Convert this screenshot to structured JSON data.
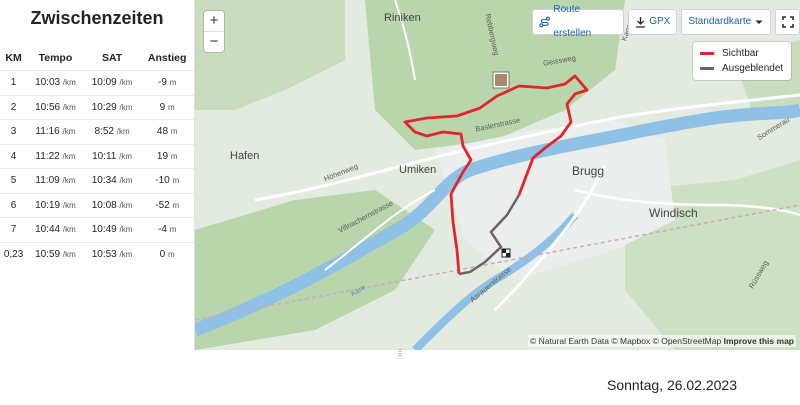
{
  "splits": {
    "title": "Zwischenzeiten",
    "headers": {
      "km": "KM",
      "tempo": "Tempo",
      "sat": "SAT",
      "anstieg": "Anstieg"
    },
    "rows": [
      {
        "km": "1",
        "tempo": "10:03",
        "sat": "10:09",
        "anstieg": "-9",
        "unit_pace": "/km",
        "unit_elev": "m"
      },
      {
        "km": "2",
        "tempo": "10:56",
        "sat": "10:29",
        "anstieg": "9",
        "unit_pace": "/km",
        "unit_elev": "m"
      },
      {
        "km": "3",
        "tempo": "11:16",
        "sat": "8:52",
        "anstieg": "48",
        "unit_pace": "/km",
        "unit_elev": "m"
      },
      {
        "km": "4",
        "tempo": "11:22",
        "sat": "10:11",
        "anstieg": "19",
        "unit_pace": "/km",
        "unit_elev": "m"
      },
      {
        "km": "5",
        "tempo": "11:09",
        "sat": "10:34",
        "anstieg": "-10",
        "unit_pace": "/km",
        "unit_elev": "m"
      },
      {
        "km": "6",
        "tempo": "10:19",
        "sat": "10:08",
        "anstieg": "-52",
        "unit_pace": "/km",
        "unit_elev": "m"
      },
      {
        "km": "7",
        "tempo": "10:44",
        "sat": "10:49",
        "anstieg": "-4",
        "unit_pace": "/km",
        "unit_elev": "m"
      },
      {
        "km": "0,23",
        "tempo": "10:59",
        "sat": "10:53",
        "anstieg": "0",
        "unit_pace": "/km",
        "unit_elev": "m"
      }
    ]
  },
  "map": {
    "zoom_in": "+",
    "zoom_out": "−",
    "toolbar": {
      "route": "Route erstellen",
      "gpx": "GPX",
      "map_type": "Standardkarte"
    },
    "legend": [
      {
        "label": "Sichtbar",
        "color": "#e3242b"
      },
      {
        "label": "Ausgeblendet",
        "color": "#6e6266"
      }
    ],
    "places": {
      "riniken": "Riniken",
      "hafen": "Hafen",
      "umiken": "Umiken",
      "brugg": "Brugg",
      "windisch": "Windisch"
    },
    "streets": {
      "baslerstrasse": "Baslerstrasse",
      "hoehenweg": "Höhenweg",
      "villnachernstrasse": "Villnachernstrasse",
      "aarauerstrasse": "Aarauerstrasse",
      "geissweg": "Geissweg",
      "rebbergweg": "Rebbergweg",
      "kaegenbach": "Kageng",
      "sommerau": "Sommerau",
      "roessweg": "Rüssweg",
      "aare": "Aare"
    },
    "attribution": {
      "text": "© Natural Earth Data © Mapbox © OpenStreetMap",
      "link": "Improve this map"
    },
    "colors": {
      "route_visible": "#e3242b",
      "route_hidden": "#6e6266",
      "river": "#8fc0e6",
      "forest": "#b7d3a8"
    }
  },
  "date": "Sonntag, 26.02.2023"
}
